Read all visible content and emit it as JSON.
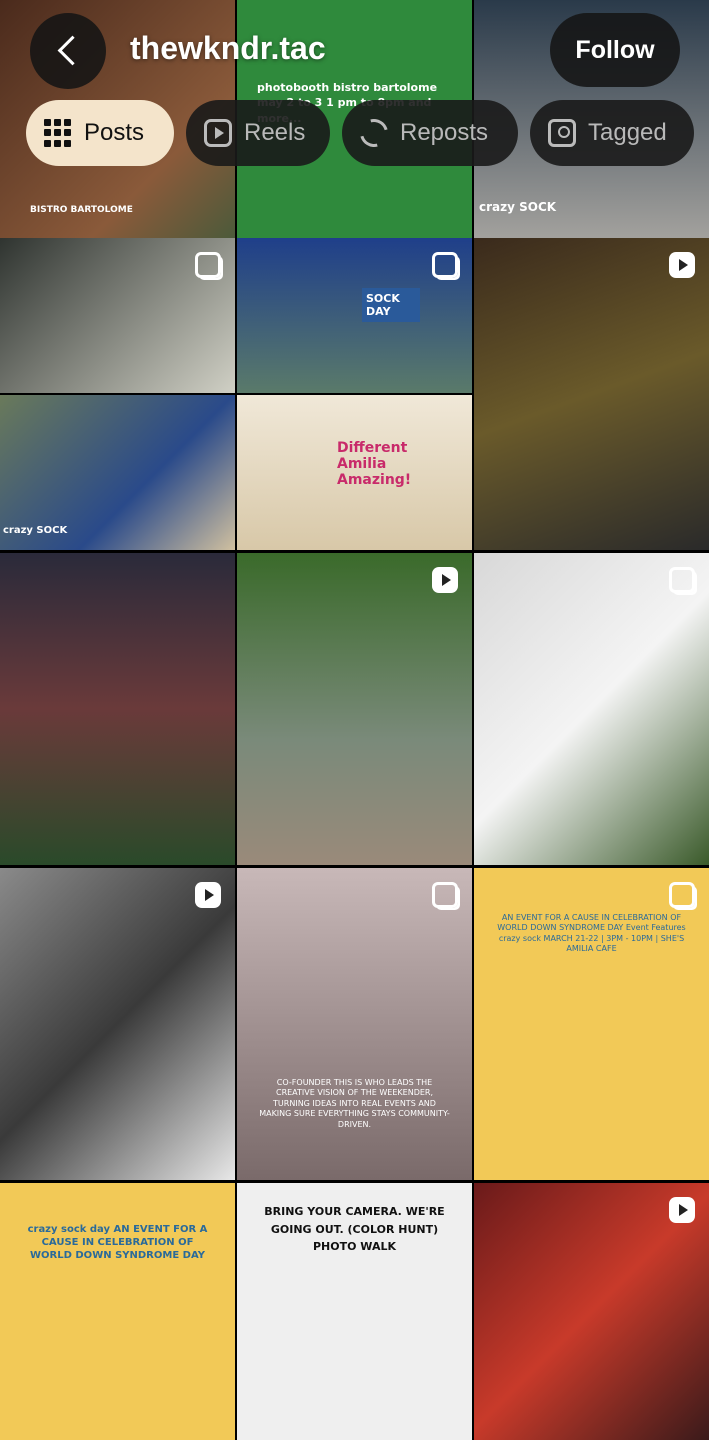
{
  "header": {
    "handle": "thewkndr.tac",
    "follow_label": "Follow"
  },
  "tabs": [
    {
      "label": "Posts",
      "icon": "grid-icon",
      "active": true
    },
    {
      "label": "Reels",
      "icon": "reels-icon",
      "active": false
    },
    {
      "label": "Reposts",
      "icon": "repost-icon",
      "active": false
    },
    {
      "label": "Tagged",
      "icon": "tagged-icon",
      "active": false
    }
  ],
  "posts": [
    {
      "type": "image",
      "text": "BISTRO BARTOLOME"
    },
    {
      "type": "image",
      "text": "photobooth  bistro bartolome  may 2 to 3  1 pm to 8pm  and more..."
    },
    {
      "type": "image",
      "text": "crazy SOCK"
    },
    {
      "type": "carousel",
      "text": ""
    },
    {
      "type": "carousel",
      "text": "SOCK DAY"
    },
    {
      "type": "reel",
      "text": ""
    },
    {
      "type": "image",
      "text": "crazy SOCK"
    },
    {
      "type": "image",
      "text": "Different Amilia Amazing!"
    },
    {
      "type": "image",
      "text": ""
    },
    {
      "type": "image",
      "text": ""
    },
    {
      "type": "reel",
      "text": ""
    },
    {
      "type": "carousel",
      "text": ""
    },
    {
      "type": "reel",
      "text": ""
    },
    {
      "type": "carousel",
      "text": "CO-FOUNDER  THIS IS WHO LEADS THE CREATIVE VISION OF THE WEEKENDER, TURNING IDEAS INTO REAL EVENTS AND MAKING SURE EVERYTHING STAYS COMMUNITY-DRIVEN."
    },
    {
      "type": "carousel",
      "text": "AN EVENT FOR A CAUSE IN CELEBRATION OF WORLD DOWN SYNDROME DAY  Event Features  crazy sock  MARCH 21-22 | 3PM - 10PM | SHE'S AMILIA CAFE"
    },
    {
      "type": "image",
      "text": "crazy sock day  AN EVENT FOR A CAUSE IN CELEBRATION OF WORLD DOWN SYNDROME DAY"
    },
    {
      "type": "image",
      "text": "BRING YOUR CAMERA. WE'RE GOING OUT.  (COLOR HUNT)  PHOTO WALK"
    },
    {
      "type": "reel",
      "text": ""
    }
  ],
  "colors": {
    "active_tab_bg": "#f4e4cb",
    "tab_bg": "#191919",
    "follow_bg": "#141414"
  }
}
